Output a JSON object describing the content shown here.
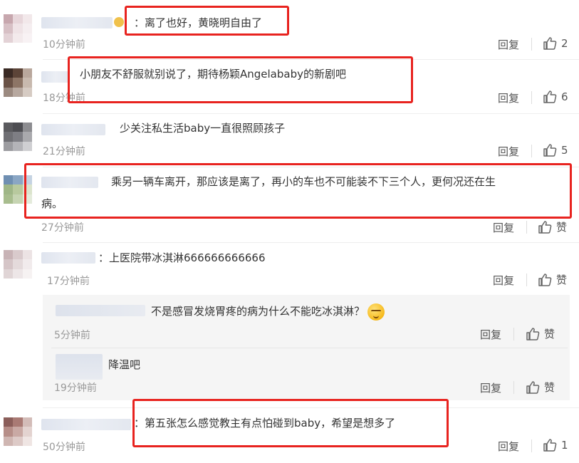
{
  "colors": {
    "highlight": "#e8231f",
    "time": "#999999",
    "panel": "#f5f5f5"
  },
  "labels": {
    "reply": "回复",
    "like": "赞"
  },
  "comments": [
    {
      "text": "：离了也好，黄晓明自由了",
      "time": "10分钟前",
      "likes": "2"
    },
    {
      "text": "小朋友不舒服就别说了，期待杨颖Angelababy的新剧吧",
      "time": "18分钟前",
      "likes": "6"
    },
    {
      "text": "少关注私生活baby一直很照顾孩子",
      "time": "21分钟前",
      "likes": "5"
    },
    {
      "text_line1": "乘另一辆车离开，那应该是离了，再小的车也不可能装不下三个人，更何况还在生",
      "text_line2": "病。",
      "time": "27分钟前",
      "likes": "赞"
    },
    {
      "text": "：上医院带冰淇淋666666666666",
      "time": "17分钟前",
      "likes": "赞"
    },
    {
      "text": "不是感冒发烧胃疼的病为什么不能吃冰淇淋？",
      "time": "5分钟前",
      "likes": "赞"
    },
    {
      "text": "降温吧",
      "time": "19分钟前",
      "likes": "赞"
    },
    {
      "text": "：第五张怎么感觉教主有点怕碰到baby，希望是想多了",
      "time": "50分钟前",
      "likes": "1"
    }
  ]
}
